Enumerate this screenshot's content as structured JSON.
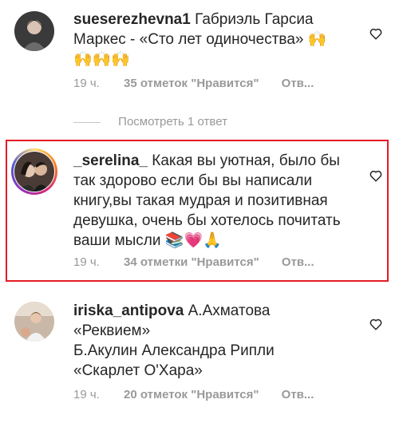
{
  "comments": [
    {
      "username": "sueserezhevna1",
      "text": "Габриэль Гарсиа Маркес - «Сто лет одиночества»",
      "emoji": "🙌🙌🙌🙌",
      "time": "19 ч.",
      "likes": "35 отметок \"Нравится\"",
      "reply": "Отв..."
    },
    {
      "username": "_serelina_",
      "text": "Какая вы уютная, было бы так здорово если бы вы написали книгу,вы такая мудрая и позитивная девушка, очень бы хотелось почитать ваши мысли",
      "emoji": "📚💗🙏",
      "time": "19 ч.",
      "likes": "34 отметки \"Нравится\"",
      "reply": "Отв..."
    },
    {
      "username": "iriska_antipova",
      "text_line1": "А.Ахматова «Реквием»",
      "text_line2": "Б.Акулин  Александра Рипли «Скарлет О'Хара»",
      "time": "19 ч.",
      "likes": "20 отметок \"Нравится\"",
      "reply": "Отв..."
    }
  ],
  "view_replies": "Посмотреть 1 ответ",
  "colors": {
    "highlight_border": "#e31b23",
    "meta_text": "#999999",
    "text": "#262626"
  }
}
